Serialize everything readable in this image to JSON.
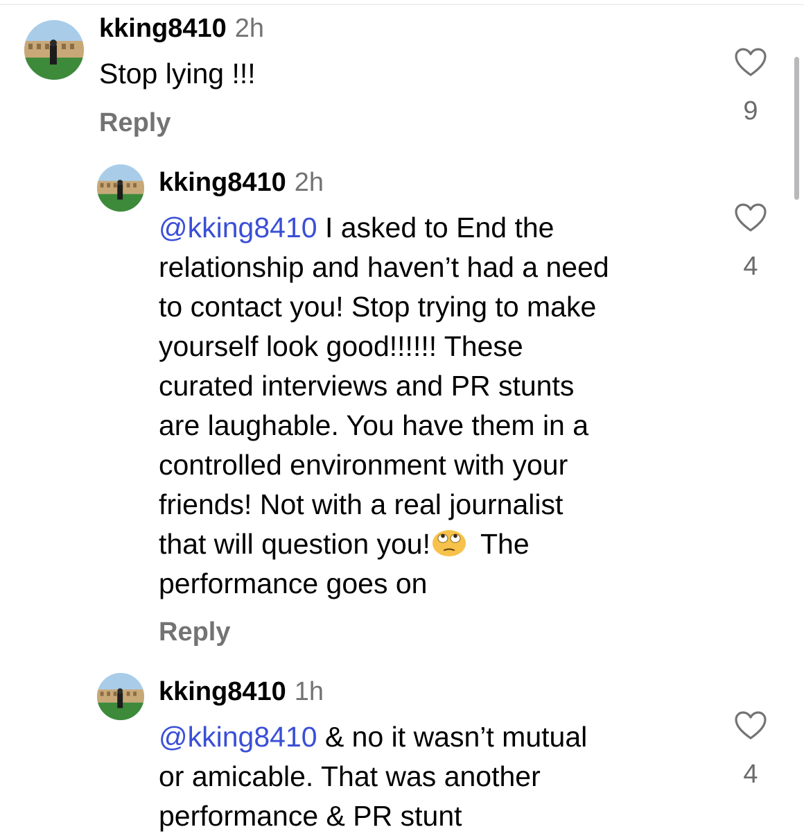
{
  "comments": [
    {
      "username": "kking8410",
      "time": "2h",
      "text": "Stop lying !!!",
      "reply_label": "Reply",
      "likes": "9"
    },
    {
      "username": "kking8410",
      "time": "2h",
      "mention": "@kking8410",
      "lines": [
        " I asked to End the",
        "relationship and haven’t had a need",
        "to contact you! Stop trying to make",
        "yourself look good!!!!!! These",
        "curated interviews and PR stunts",
        "are laughable. You have them in a",
        "controlled environment with your",
        "friends! Not with a real journalist",
        "that will question you!",
        "The",
        "performance goes on"
      ],
      "emoji": "face-with-rolling-eyes-emoji",
      "reply_label": "Reply",
      "likes": "4"
    },
    {
      "username": "kking8410",
      "time": "1h",
      "mention": "@kking8410",
      "lines": [
        " & no it wasn’t mutual",
        "or amicable. That was another",
        "performance & PR stunt"
      ],
      "likes": "4"
    }
  ],
  "icons": {
    "like": "heart-outline-icon",
    "avatar": "profile-photo"
  },
  "colors": {
    "mention": "#3a4fd6",
    "secondary_text": "#737373"
  }
}
